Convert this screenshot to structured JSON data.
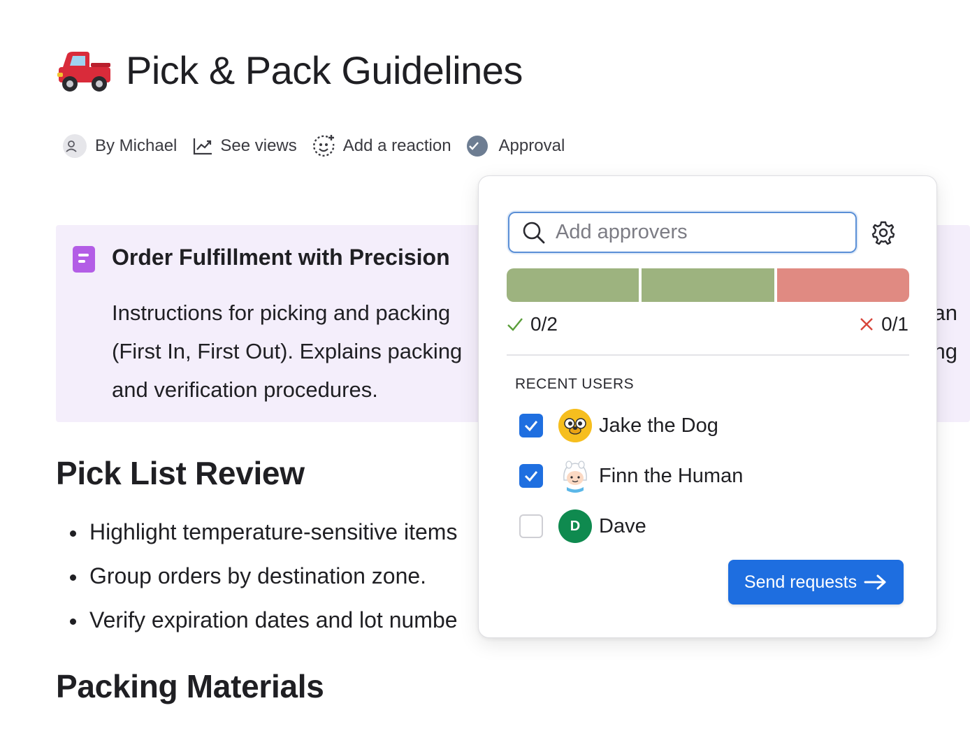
{
  "doc": {
    "title": "Pick & Pack Guidelines",
    "title_icon": "pickup-truck-icon"
  },
  "meta": {
    "author": "By Michael",
    "views": "See views",
    "reaction": "Add a reaction",
    "approval": "Approval"
  },
  "callout": {
    "icon": "form-icon",
    "title": "Order Fulfillment with Precision",
    "body_line1": "Instructions for picking and packing",
    "body_line1_tail": "an",
    "body_line2": "(First In, First Out). Explains packing",
    "body_line2_tail": "ing",
    "body_line3": "and verification procedures."
  },
  "sections": {
    "pick_list": {
      "heading": "Pick List Review",
      "items": [
        "Highlight temperature-sensitive items",
        "Group orders by destination zone.",
        "Verify expiration dates and lot numbe"
      ]
    },
    "packing": {
      "heading": "Packing Materials"
    }
  },
  "approval_popover": {
    "search_placeholder": "Add approvers",
    "approved_count": "0/2",
    "rejected_count": "0/1",
    "colors": {
      "approve_segment": "#9db37f",
      "reject_segment": "#e08a82",
      "approve_check": "#5a9e3a",
      "reject_x": "#d8453a",
      "primary": "#1e6ee0"
    },
    "recent_label": "RECENT USERS",
    "users": [
      {
        "name": "Jake the Dog",
        "checked": true,
        "avatar": "jake-avatar"
      },
      {
        "name": "Finn the Human",
        "checked": true,
        "avatar": "finn-avatar"
      },
      {
        "name": "Dave",
        "checked": false,
        "avatar_initial": "D"
      }
    ],
    "send_label": "Send requests"
  }
}
